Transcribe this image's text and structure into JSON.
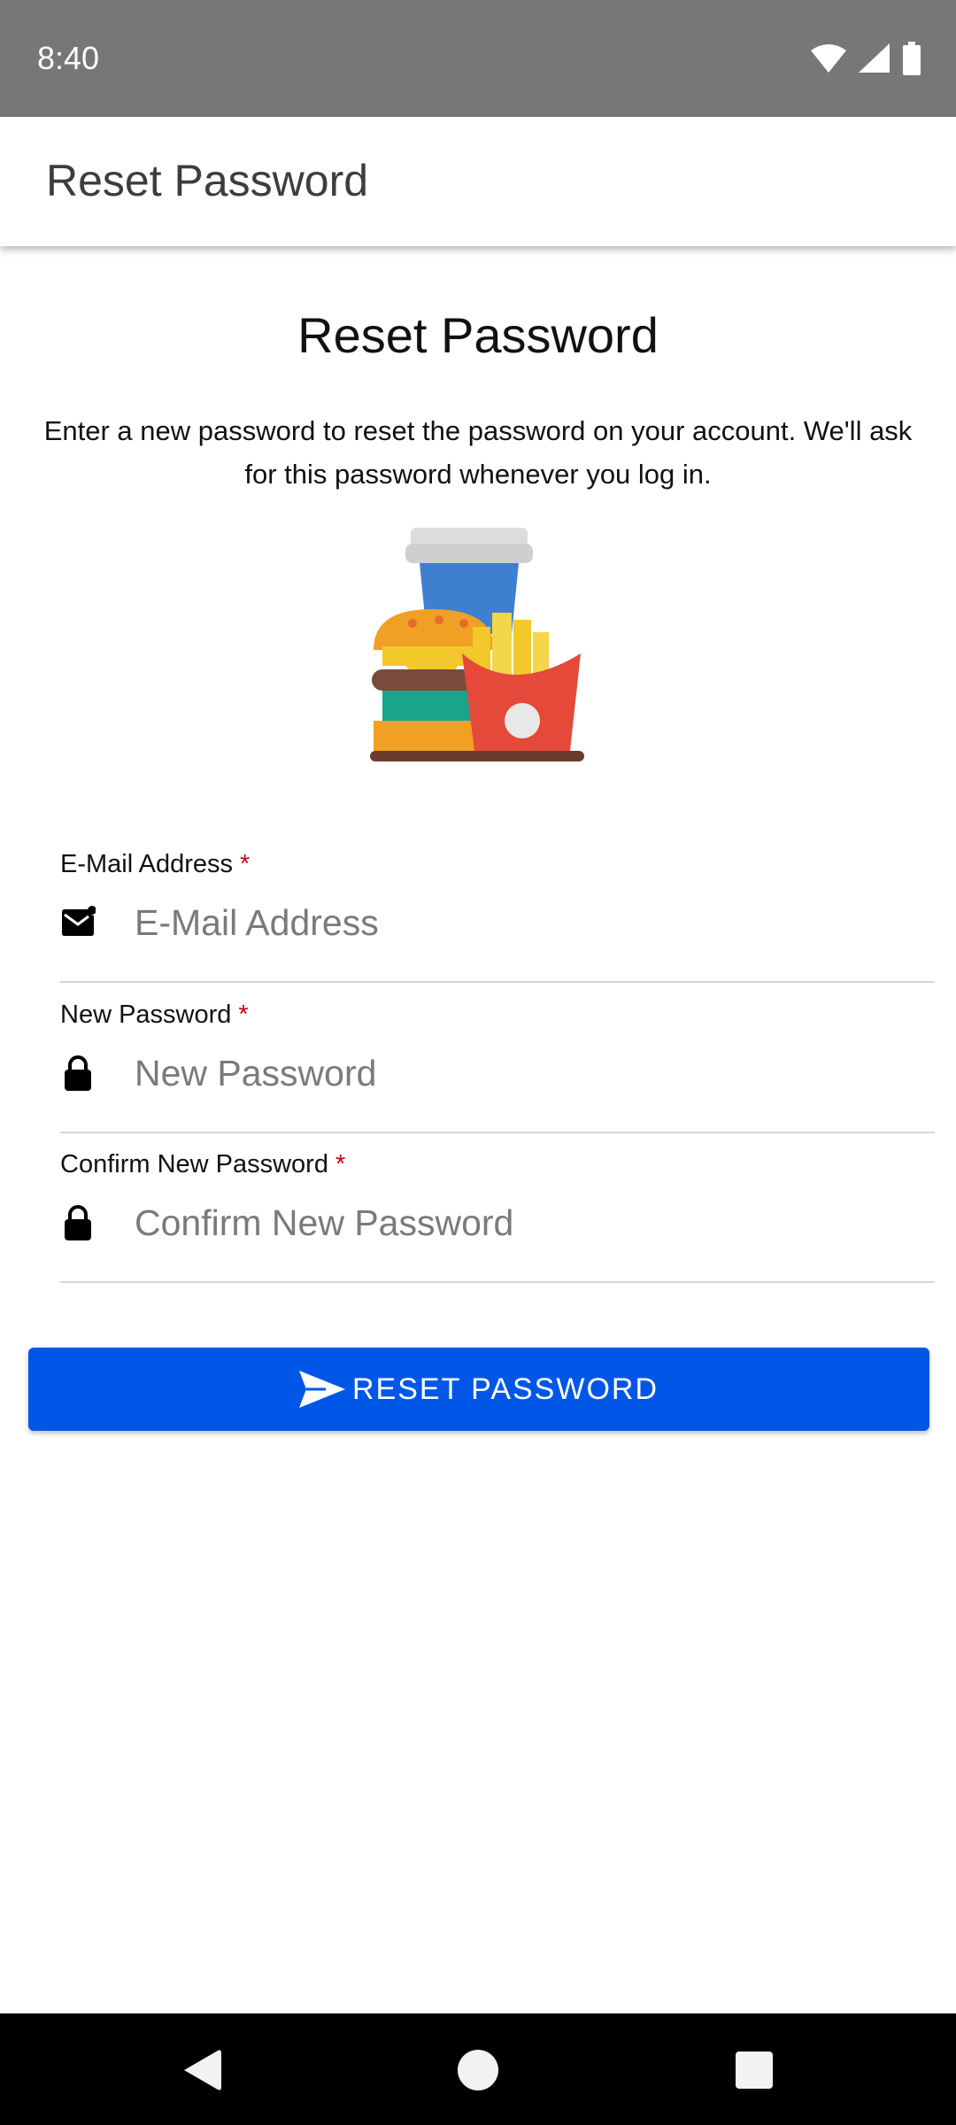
{
  "status_bar": {
    "time": "8:40",
    "icons": [
      "wifi-icon",
      "signal-icon",
      "battery-icon"
    ]
  },
  "app_bar": {
    "title": "Reset Password"
  },
  "main": {
    "heading": "Reset Password",
    "description": "Enter a new password to reset the password on your account. We'll ask for this password whenever you log in.",
    "illustration": "fast-food-illustration"
  },
  "form": {
    "email": {
      "label": "E-Mail Address",
      "required_marker": "*",
      "placeholder": "E-Mail Address",
      "value": "",
      "icon": "email-icon"
    },
    "new_password": {
      "label": "New Password",
      "required_marker": "*",
      "placeholder": "New Password",
      "value": "",
      "icon": "lock-icon"
    },
    "confirm_password": {
      "label": "Confirm New Password",
      "required_marker": "*",
      "placeholder": "Confirm New Password",
      "value": "",
      "icon": "lock-icon"
    },
    "submit_label": "RESET PASSWORD",
    "submit_icon": "send-icon"
  },
  "nav_bar": {
    "buttons": [
      "back-icon",
      "home-icon",
      "recents-icon"
    ]
  },
  "colors": {
    "status_bar": "#777777",
    "primary_button": "#0057e7",
    "required_marker": "#c4001a",
    "nav_bar": "#000000"
  }
}
